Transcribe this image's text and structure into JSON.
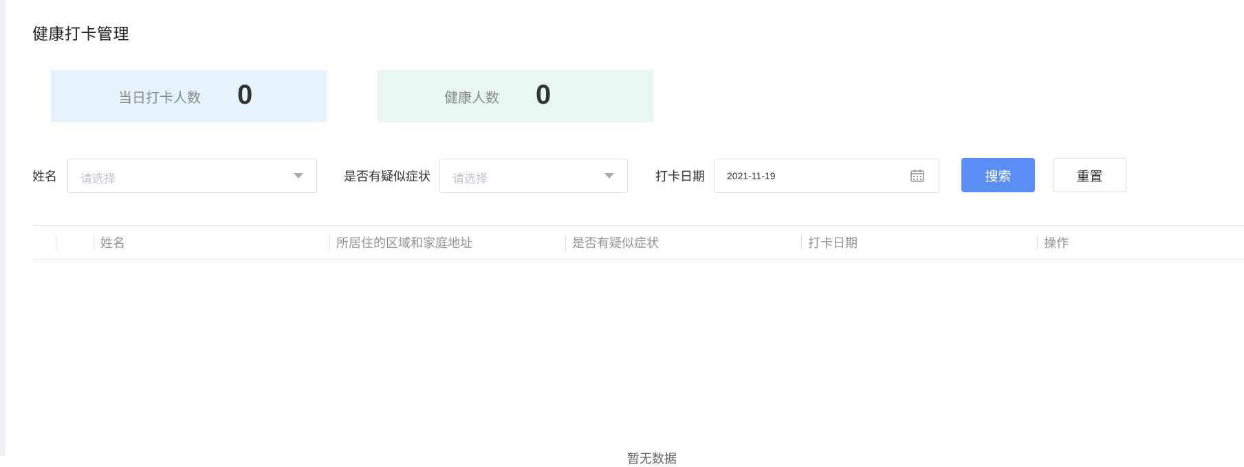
{
  "page": {
    "title": "健康打卡管理"
  },
  "stats": {
    "checkin": {
      "label": "当日打卡人数",
      "value": "0"
    },
    "healthy": {
      "label": "健康人数",
      "value": "0"
    }
  },
  "filters": {
    "name": {
      "label": "姓名",
      "placeholder": "请选择"
    },
    "symptom": {
      "label": "是否有疑似症状",
      "placeholder": "请选择"
    },
    "date": {
      "label": "打卡日期",
      "value": "2021-11-19"
    },
    "search_label": "搜索",
    "reset_label": "重置"
  },
  "table": {
    "columns": [
      "",
      "姓名",
      "所居住的区域和家庭地址",
      "是否有疑似症状",
      "打卡日期",
      "操作"
    ],
    "empty_text": "暂无数据"
  },
  "colors": {
    "primary": "#5b8ef5",
    "blue_card": "#e6f3fd",
    "green_card": "#e8f8f0"
  }
}
